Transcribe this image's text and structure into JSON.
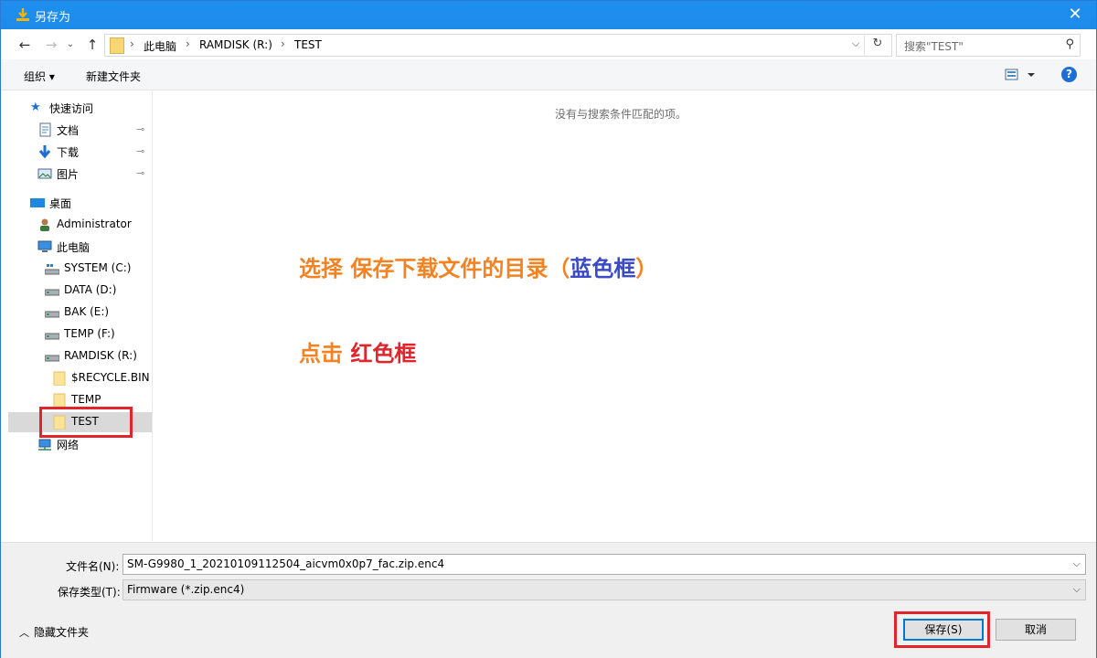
{
  "window": {
    "title": "另存为",
    "close_glyph": "✕"
  },
  "nav": {
    "back": "←",
    "forward": "→",
    "up": "↑",
    "breadcrumb": [
      "此电脑",
      "RAMDISK (R:)",
      "TEST"
    ],
    "sep": "›",
    "dropdown": "⌵",
    "refresh": "↻",
    "search_placeholder": "搜索\"TEST\"",
    "search_icon": "⚲"
  },
  "toolbar": {
    "organize": "组织 ▾",
    "new_folder": "新建文件夹",
    "help": "?"
  },
  "sidebar": {
    "items": [
      {
        "label": "快速访问",
        "icon": "star-icon"
      },
      {
        "label": "文档",
        "icon": "document-icon",
        "pinned": true
      },
      {
        "label": "下载",
        "icon": "download-icon",
        "pinned": true
      },
      {
        "label": "图片",
        "icon": "picture-icon",
        "pinned": true
      },
      {
        "label": "桌面",
        "icon": "desktop-icon"
      },
      {
        "label": "Administrator",
        "icon": "user-icon"
      },
      {
        "label": "此电脑",
        "icon": "computer-icon"
      },
      {
        "label": "SYSTEM (C:)",
        "icon": "system-drive-icon"
      },
      {
        "label": "DATA (D:)",
        "icon": "drive-icon"
      },
      {
        "label": "BAK (E:)",
        "icon": "drive-icon"
      },
      {
        "label": "TEMP (F:)",
        "icon": "drive-icon"
      },
      {
        "label": "RAMDISK (R:)",
        "icon": "drive-icon"
      },
      {
        "label": "$RECYCLE.BIN",
        "icon": "folder-icon"
      },
      {
        "label": "TEMP",
        "icon": "folder-icon"
      },
      {
        "label": "TEST",
        "icon": "folder-icon",
        "selected": true
      },
      {
        "label": "网络",
        "icon": "network-icon"
      }
    ],
    "pin_glyph": "📌"
  },
  "main": {
    "empty_message": "没有与搜索条件匹配的项。",
    "annotation1_orange": "选择 保存下载文件的目录（",
    "annotation1_blue": "蓝色框",
    "annotation1_tail": "）",
    "annotation2_orange": "点击 ",
    "annotation2_red": "红色框"
  },
  "form": {
    "filename_label": "文件名(N):",
    "filename_value": "SM-G9980_1_20210109112504_aicvm0x0p7_fac.zip.enc4",
    "filetype_label": "保存类型(T):",
    "filetype_value": "Firmware (*.zip.enc4)",
    "hide_folders": "隐藏文件夹",
    "save": "保存(S)",
    "cancel": "取消"
  },
  "colors": {
    "titlebar": "#1d8bea",
    "annotation_orange": "#f58220",
    "annotation_blue": "#3b4bc8",
    "annotation_red": "#e0262c"
  }
}
